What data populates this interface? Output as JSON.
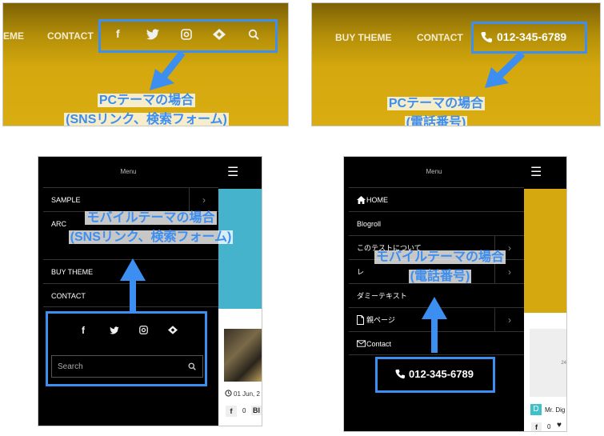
{
  "colors": {
    "accent": "#3c8ef0",
    "gold": "#d4a80e",
    "black": "#000000",
    "teal": "#45b3cc"
  },
  "pc_sns": {
    "nav": [
      "EME",
      "CONTACT"
    ],
    "icons": [
      "facebook-icon",
      "twitter-icon",
      "instagram-icon",
      "feedly-icon",
      "search-icon"
    ],
    "callout_line1": "PCテーマの場合",
    "callout_line2": "(SNSリンク、検索フォーム)"
  },
  "pc_phone": {
    "nav": [
      "BUY THEME",
      "CONTACT"
    ],
    "phone": "012-345-6789",
    "callout_line1": "PCテーマの場合",
    "callout_line2": "(電話番号)"
  },
  "mobile_sns": {
    "menu_title": "Menu",
    "items": [
      "SAMPLE",
      "ARC",
      "BUY THEME",
      "CONTACT"
    ],
    "search_placeholder": "Search",
    "callout_line1": "モバイルテーマの場合",
    "callout_line2": "(SNSリンク、検索フォーム)",
    "post_date": "01 Jun, 2",
    "post_count": "0",
    "post_partial": "Bl"
  },
  "mobile_phone": {
    "menu_title": "Menu",
    "items": [
      "HOME",
      "Blogroll",
      "このテストについて",
      "レ",
      "ダミーテキスト",
      "親ページ",
      "Contact"
    ],
    "phone": "012-345-6789",
    "callout_line1": "モバイルテーマの場合",
    "callout_line2": "(電話番号)",
    "side_text": "24",
    "avatar_letter": "D",
    "author_partial": "Mr. Dig",
    "post_count": "0"
  }
}
